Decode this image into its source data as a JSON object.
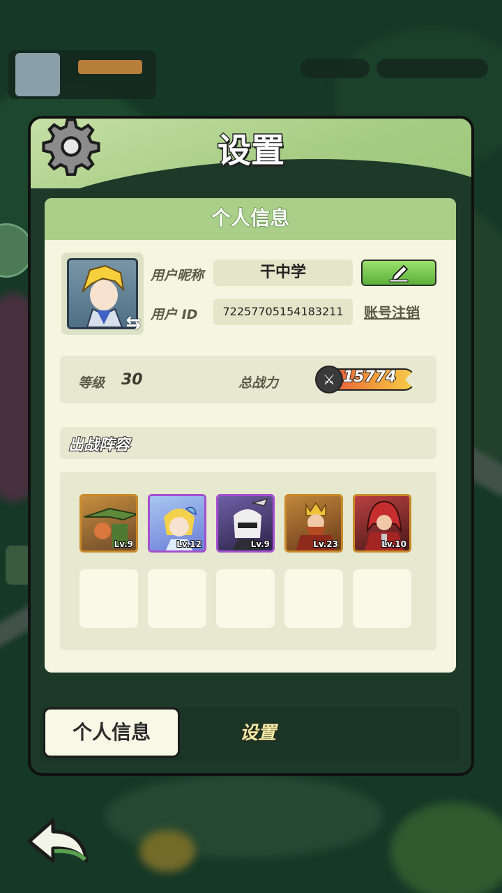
{
  "panel": {
    "title": "设置",
    "section_title": "个人信息"
  },
  "profile": {
    "nickname_label": "用户昵称",
    "nickname": "干中学",
    "id_label": "用户  ID",
    "user_id": "72257705154183211",
    "logout_label": "账号注销"
  },
  "stats": {
    "level_label": "等级",
    "level": "30",
    "power_label": "总战力",
    "power": "15774"
  },
  "lineup": {
    "title": "出战阵容",
    "heroes": [
      {
        "name": "crocodile-warrior",
        "level": "Lv.9",
        "rarity": "orange"
      },
      {
        "name": "fairy-girl",
        "level": "Lv.12",
        "rarity": "purple"
      },
      {
        "name": "masked-swordswoman",
        "level": "Lv.9",
        "rarity": "purple"
      },
      {
        "name": "bearded-king",
        "level": "Lv.23",
        "rarity": "orange"
      },
      {
        "name": "red-hooded-mage",
        "level": "Lv.10",
        "rarity": "orange"
      }
    ],
    "empty_slots": 5
  },
  "tabs": {
    "active": "个人信息",
    "inactive": "设置"
  },
  "colors": {
    "header_green": "#a6cd84",
    "panel_bg": "#f5f6e0",
    "edit_button": "#5bb03a",
    "orange_rarity": "#c98a2a",
    "purple_rarity": "#a44fd0"
  }
}
